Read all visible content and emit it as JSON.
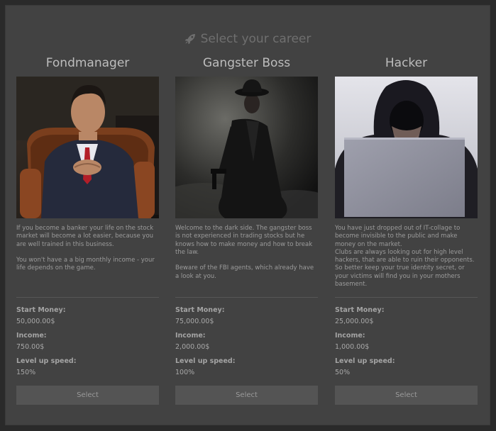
{
  "header": {
    "icon": "rocket-icon",
    "title": "Select your career"
  },
  "cards": [
    {
      "title": "Fondmanager",
      "image": "banker-portrait",
      "description": [
        "If you become a banker your life on the stock market will become a lot easier, because you are well trained in this business.",
        "You won't have a a big monthly income - your life depends on the game."
      ],
      "stats": [
        {
          "label": "Start Money:",
          "value": "50,000.00$"
        },
        {
          "label": "Income:",
          "value": "750.00$"
        },
        {
          "label": "Level up speed:",
          "value": "150%"
        }
      ],
      "button": "Select"
    },
    {
      "title": "Gangster Boss",
      "image": "gangster-portrait",
      "description": [
        "Welcome to the dark side. The gangster boss is not experienced in trading stocks but he knows how to make money and how to break the law.",
        "Beware of the FBI agents, which already have a look at you."
      ],
      "stats": [
        {
          "label": "Start Money:",
          "value": "75,000.00$"
        },
        {
          "label": "Income:",
          "value": "2,000.00$"
        },
        {
          "label": "Level up speed:",
          "value": "100%"
        }
      ],
      "button": "Select"
    },
    {
      "title": "Hacker",
      "image": "hacker-portrait",
      "description": [
        "You have just dropped out of IT-collage to become invisible to the public and make money on the market.\nClubs are always looking out for high level hackers, that are able to ruin their opponents. So better keep your true identity secret, or your victims will find you in your mothers basement."
      ],
      "stats": [
        {
          "label": "Start Money:",
          "value": "25,000.00$"
        },
        {
          "label": "Income:",
          "value": "1,000.00$"
        },
        {
          "label": "Level up speed:",
          "value": "50%"
        }
      ],
      "button": "Select"
    }
  ]
}
